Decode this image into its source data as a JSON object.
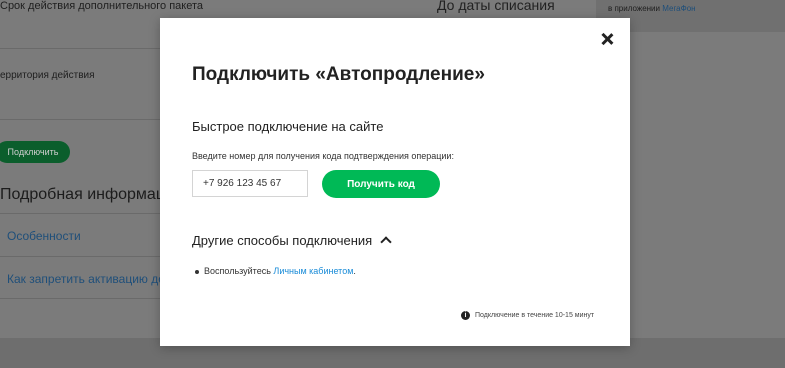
{
  "background": {
    "validity_label": "Срок действия дополнительного пакета",
    "until_label": "До даты списания",
    "right_panel_text": "в приложении",
    "right_panel_link": "МегаФон",
    "territory_label": "ерритория действия",
    "connect_button": "Подключить",
    "details_heading": "Подробная информация",
    "link_features": "Особенности",
    "link_prohibit": "Как запретить активацию до"
  },
  "modal": {
    "title": "Подключить «Автопродление»",
    "quick_subtitle": "Быстрое подключение на сайте",
    "hint": "Введите номер для получения кода подтверждения операции:",
    "phone_value": "+7 926 123 45 67",
    "get_code_button": "Получить код",
    "other_methods": "Другие способы подключения",
    "use_prefix": "Воспользуйтесь",
    "cabinet_link": "Личным кабинетом",
    "use_suffix": ".",
    "info_icon_glyph": "i",
    "info_text": "Подключение в течение 10-15 минут"
  },
  "colors": {
    "accent_green": "#00b956",
    "link_blue": "#1a8cd8"
  }
}
